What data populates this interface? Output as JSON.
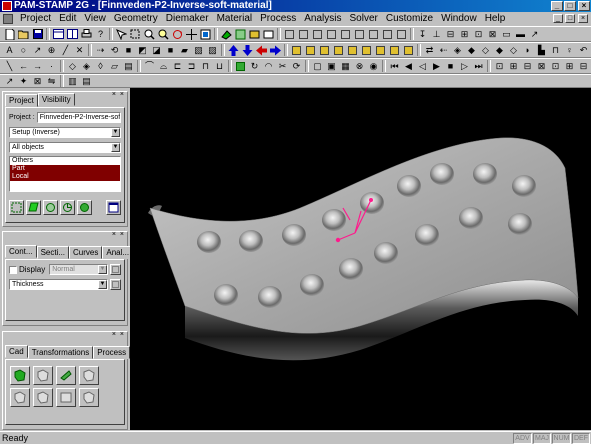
{
  "window": {
    "title": "PAM-STAMP 2G - [Finnveden-P2-Inverse-soft-material]",
    "controls": [
      "_",
      "□",
      "×"
    ]
  },
  "menu": {
    "items": [
      "Project",
      "Edit",
      "View",
      "Geometry",
      "Diemaker",
      "Material",
      "Process",
      "Analysis",
      "Solver",
      "Customize",
      "Window",
      "Help"
    ],
    "mdi_controls": [
      "_",
      "□",
      "×"
    ]
  },
  "project_panel": {
    "tabs": [
      "Project",
      "Visibility"
    ],
    "project_label": "Project :",
    "project_value": "Finnveden-P2-Inverse-soft-r",
    "setup_select": "Setup (Inverse)",
    "objects_select": "All objects",
    "object_list": [
      "Others",
      "Part",
      "Local"
    ],
    "selected_items": [
      "Part",
      "Local"
    ],
    "panel_handle": "× ×"
  },
  "contour_panel": {
    "tabs": [
      "Cont...",
      "Secti...",
      "Curves",
      "Anal..."
    ],
    "display_label": "Display",
    "display_mode": "Normal",
    "field_select": "Thickness",
    "panel_handle": "× ×"
  },
  "cad_panel": {
    "tabs": [
      "Cad",
      "Transformations",
      "Process"
    ],
    "panel_handle": "× ×"
  },
  "status": {
    "text": "Ready",
    "indicators": [
      "ADV",
      "MAJ",
      "NUM",
      "DEF"
    ]
  },
  "colors": {
    "title_start": "#000080",
    "title_end": "#1084d0",
    "selection": "#800000",
    "viewport_bg": "#000000",
    "axis": "#ff1a8c",
    "part": "#a8a8a8"
  }
}
